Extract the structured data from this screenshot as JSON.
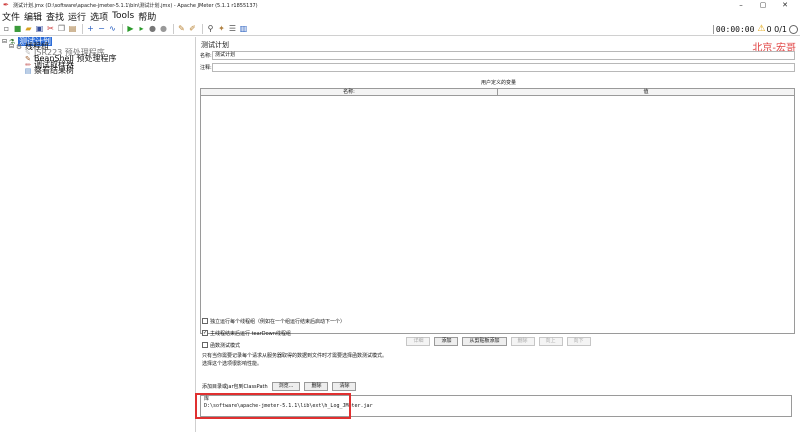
{
  "window": {
    "title": "测试计划.jmx (D:\\software\\apache-jmeter-5.1.1\\bin\\测试计划.jmx) - Apache JMeter (5.1.1 r1855137)",
    "controls": {
      "minimize": "–",
      "maximize": "▢",
      "close": "✕"
    }
  },
  "menu": {
    "items": [
      "文件",
      "编辑",
      "查找",
      "运行",
      "选项",
      "Tools",
      "帮助"
    ]
  },
  "toolbar": {
    "icons": [
      "new-icon",
      "templates-icon",
      "open-icon",
      "save-icon",
      "cut-icon",
      "copy-icon",
      "paste-icon",
      "expand-icon",
      "collapse-icon",
      "toggle-icon",
      "start-icon",
      "start-no-pause-icon",
      "stop-icon",
      "shutdown-icon",
      "clear-icon",
      "clear-all-icon",
      "search-icon",
      "reset-search-icon",
      "function-helper-icon",
      "help-icon"
    ]
  },
  "status": {
    "timer": "00:00:00",
    "counts": "0  0/1"
  },
  "tree": {
    "root": "测试计划",
    "thread_group": "线程组",
    "jsr223": "JSR223 预处理程序",
    "beanshell": "BeanShell 预处理程序",
    "debug_sampler": "调试取样器",
    "results_tree": "察看结果树"
  },
  "panel": {
    "title": "测试计划",
    "watermark": "北京-宏哥",
    "name_label": "名称:",
    "name_value": "测试计划",
    "comment_label": "注释:",
    "comment_value": ""
  },
  "variables": {
    "title": "用户定义的变量",
    "columns": [
      "名称:",
      "值"
    ]
  },
  "buttons": {
    "detail": "详细",
    "add": "添加",
    "add_clipboard": "从剪贴板添加",
    "delete": "删除",
    "up": "向上",
    "down": "向下"
  },
  "options": {
    "serialize": "独立运行每个线程组（例如在一个组运行结束后启动下一个）",
    "teardown": "主线程结束后运行 tearDown线程组",
    "functional": "函数测试模式",
    "note1": "只有当你需要记录每个请求从服务器取得的数据到文件时才需要选择函数测试模式。",
    "note2": "选择这个选项很影响性能。"
  },
  "classpath": {
    "label": "添加目录或jar包到ClassPath",
    "browse": "浏览...",
    "delete": "删除",
    "clear": "清除",
    "lib_header": "库",
    "lib_entry": "D:\\software\\apache-jmeter-5.1.1\\lib\\ext\\h_Log_JMeter.jar"
  }
}
